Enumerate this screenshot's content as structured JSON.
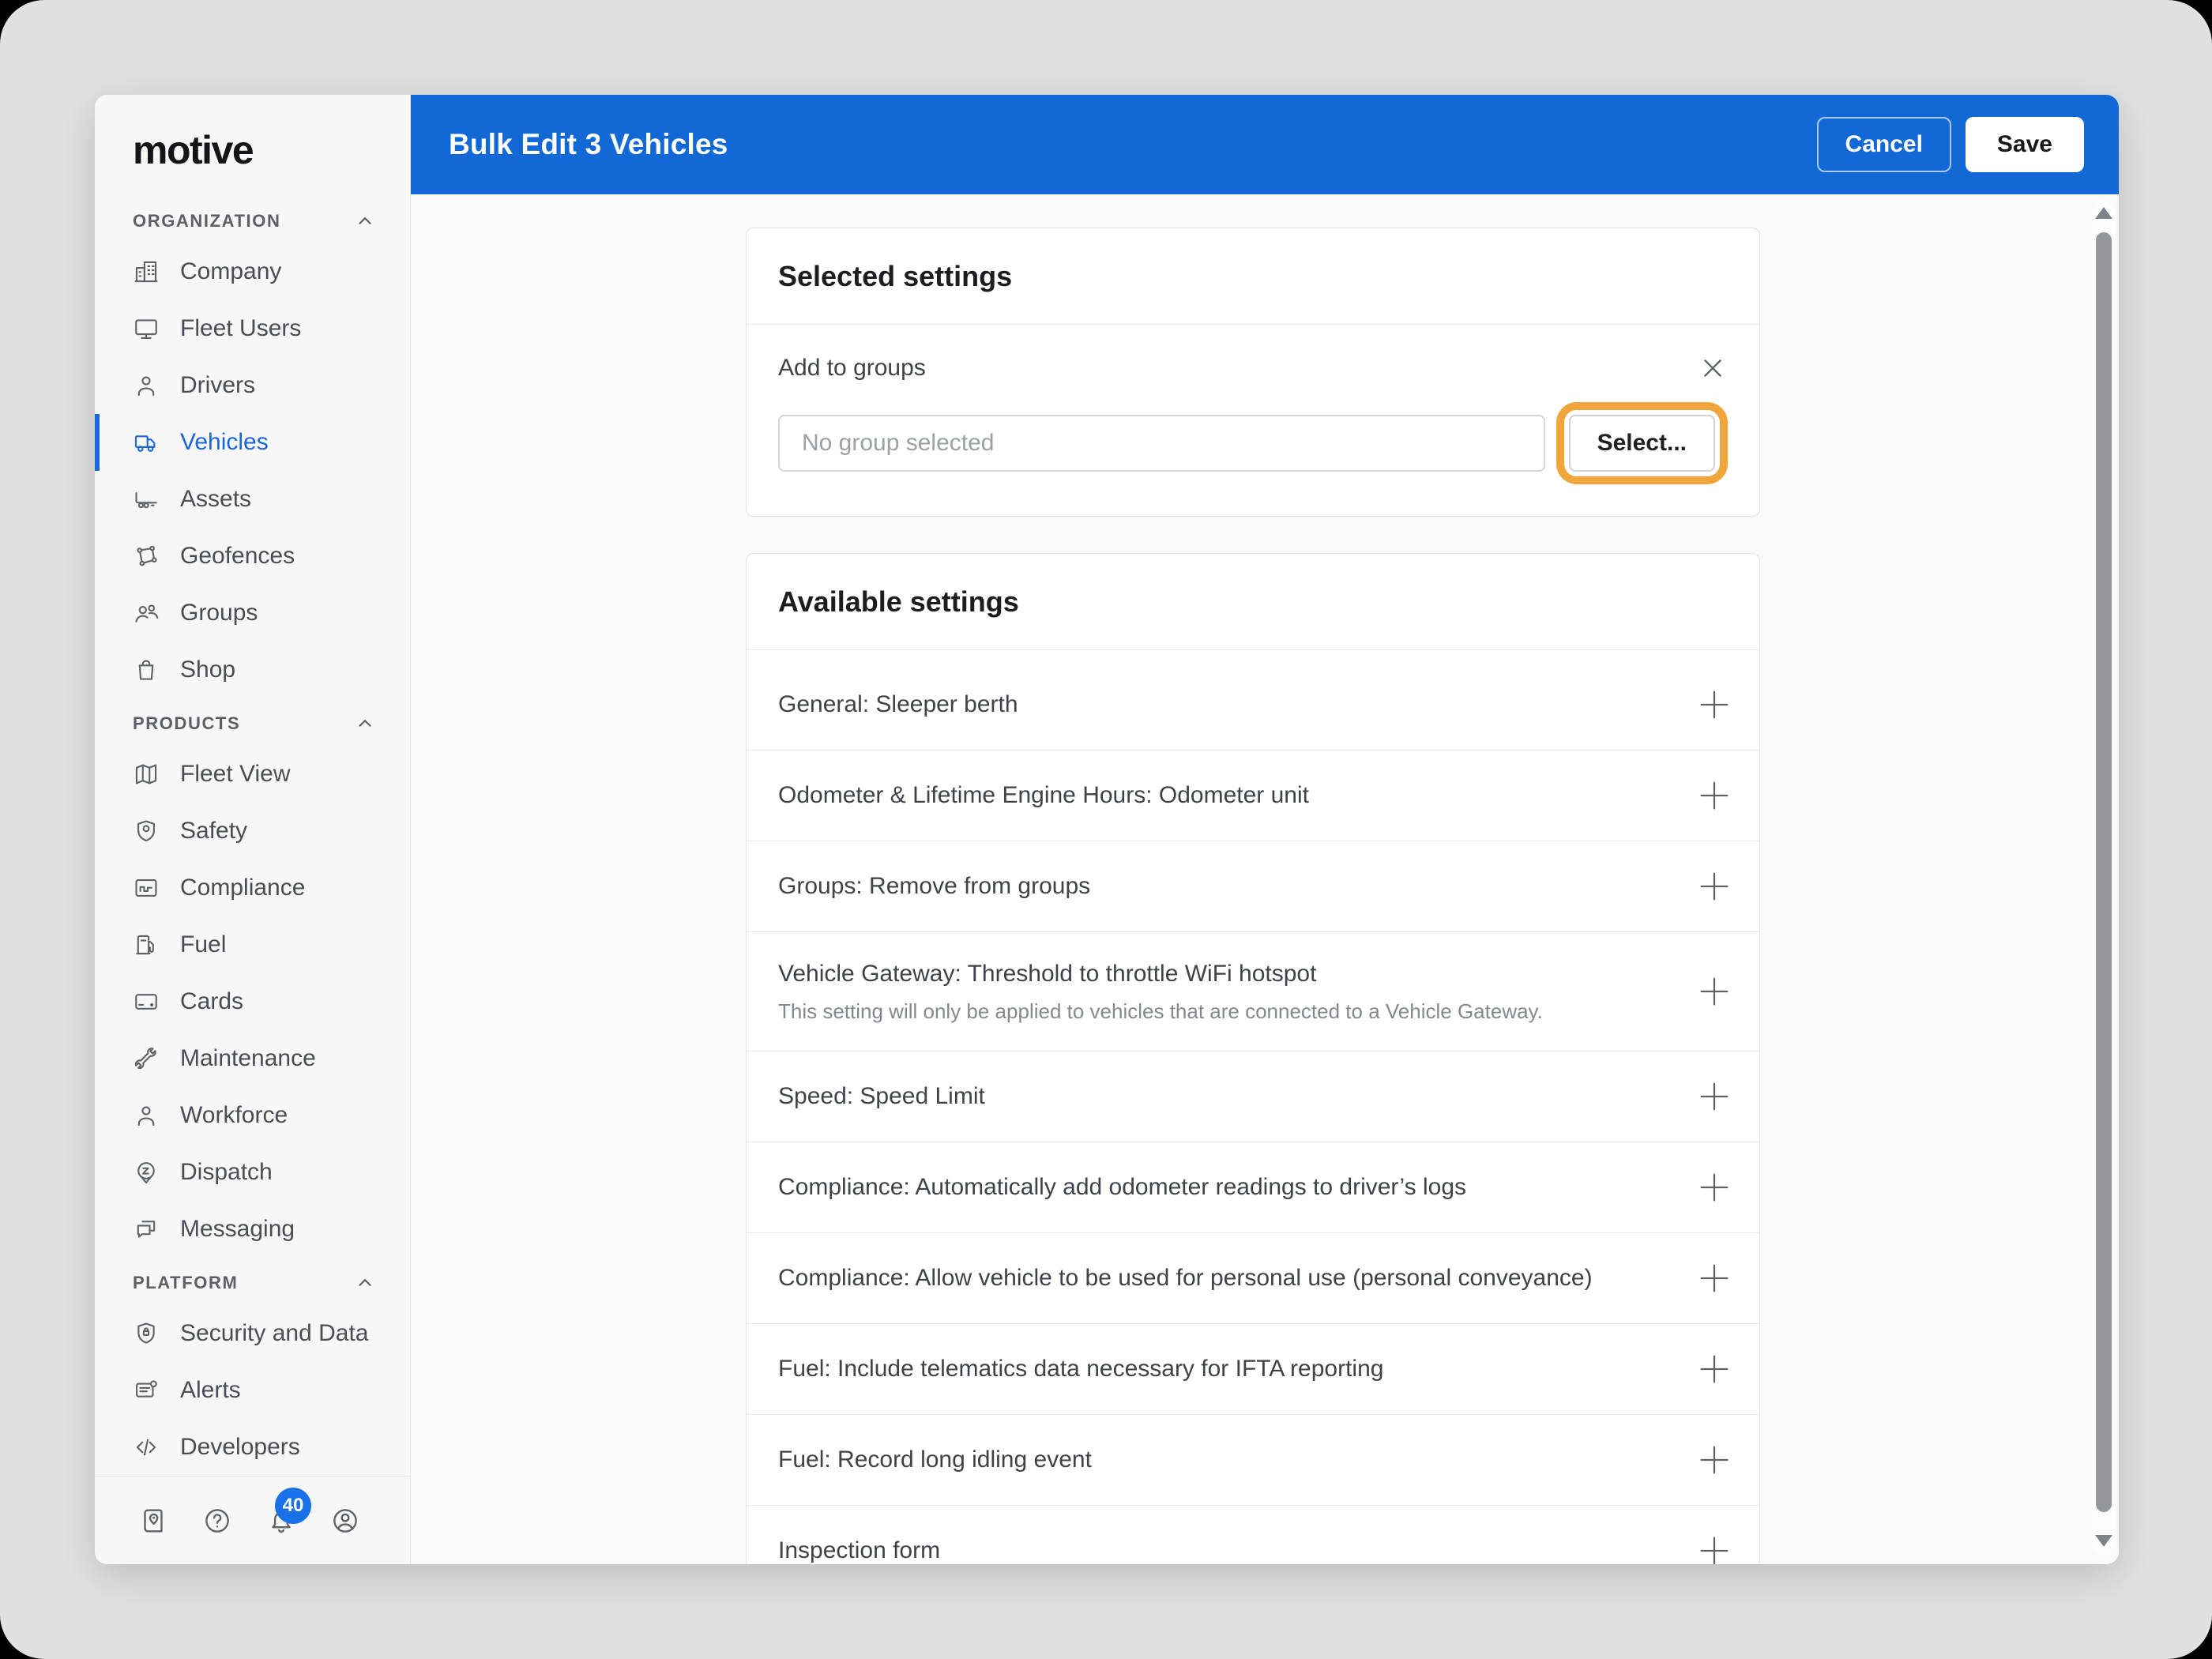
{
  "brand": {
    "logo_text": "motive"
  },
  "header": {
    "title": "Bulk Edit 3 Vehicles",
    "cancel_label": "Cancel",
    "save_label": "Save"
  },
  "sidebar": {
    "entries": [
      {
        "type": "section",
        "label": "ORGANIZATION"
      },
      {
        "type": "item",
        "label": "Company",
        "icon": "company"
      },
      {
        "type": "item",
        "label": "Fleet Users",
        "icon": "fleet-users"
      },
      {
        "type": "item",
        "label": "Drivers",
        "icon": "drivers"
      },
      {
        "type": "item",
        "label": "Vehicles",
        "icon": "vehicles",
        "selected": true
      },
      {
        "type": "item",
        "label": "Assets",
        "icon": "assets"
      },
      {
        "type": "item",
        "label": "Geofences",
        "icon": "geofences"
      },
      {
        "type": "item",
        "label": "Groups",
        "icon": "groups"
      },
      {
        "type": "item",
        "label": "Shop",
        "icon": "shop"
      },
      {
        "type": "section",
        "label": "PRODUCTS"
      },
      {
        "type": "item",
        "label": "Fleet View",
        "icon": "fleet-view"
      },
      {
        "type": "item",
        "label": "Safety",
        "icon": "safety"
      },
      {
        "type": "item",
        "label": "Compliance",
        "icon": "compliance"
      },
      {
        "type": "item",
        "label": "Fuel",
        "icon": "fuel"
      },
      {
        "type": "item",
        "label": "Cards",
        "icon": "cards"
      },
      {
        "type": "item",
        "label": "Maintenance",
        "icon": "maintenance"
      },
      {
        "type": "item",
        "label": "Workforce",
        "icon": "workforce"
      },
      {
        "type": "item",
        "label": "Dispatch",
        "icon": "dispatch"
      },
      {
        "type": "item",
        "label": "Messaging",
        "icon": "messaging"
      },
      {
        "type": "section",
        "label": "PLATFORM"
      },
      {
        "type": "item",
        "label": "Security and Data",
        "icon": "security"
      },
      {
        "type": "item",
        "label": "Alerts",
        "icon": "alerts"
      },
      {
        "type": "item",
        "label": "Developers",
        "icon": "developers"
      }
    ],
    "footer": {
      "buttons": [
        {
          "icon": "guide"
        },
        {
          "icon": "help"
        },
        {
          "icon": "notifications",
          "badge": "40"
        },
        {
          "icon": "account"
        }
      ]
    }
  },
  "selected_settings": {
    "title": "Selected settings",
    "setting": {
      "label": "Add to groups",
      "placeholder": "No group selected",
      "button_label": "Select..."
    }
  },
  "available_settings": {
    "title": "Available settings",
    "rows": [
      {
        "label": "General: Sleeper berth"
      },
      {
        "label": "Odometer & Lifetime Engine Hours: Odometer unit"
      },
      {
        "label": "Groups: Remove from groups"
      },
      {
        "label": "Vehicle Gateway: Threshold to throttle WiFi hotspot",
        "description": "This setting will only be applied to vehicles that are connected to a Vehicle Gateway."
      },
      {
        "label": "Speed: Speed Limit"
      },
      {
        "label": "Compliance: Automatically add odometer readings to driver’s logs"
      },
      {
        "label": "Compliance: Allow vehicle to be used for personal use (personal conveyance)"
      },
      {
        "label": "Fuel: Include telematics data necessary for IFTA reporting"
      },
      {
        "label": "Fuel: Record long idling event"
      },
      {
        "label": "Inspection form"
      }
    ]
  },
  "colors": {
    "header_blue": "#1269d6",
    "accent_blue": "#1b66d9",
    "badge_blue": "#1a70e8",
    "highlight_orange": "#f0a63b"
  }
}
